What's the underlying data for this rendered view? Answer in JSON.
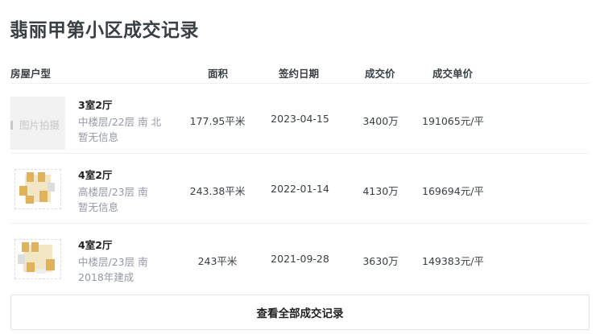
{
  "title": "翡丽甲第小区成交记录",
  "headers": {
    "layout": "房屋户型",
    "area": "面积",
    "date": "签约日期",
    "price": "成交价",
    "unit_price": "成交单价"
  },
  "placeholder_text": "图片拍摄",
  "records": [
    {
      "rooms": "3室2厅",
      "floor": "中楼层/22层 南 北",
      "extra": "暂无信息",
      "area": "177.95平米",
      "date": "2023-04-15",
      "price": "3400万",
      "unit_price": "191065元/平"
    },
    {
      "rooms": "4室2厅",
      "floor": "高楼层/23层 南",
      "extra": "暂无信息",
      "area": "243.38平米",
      "date": "2022-01-14",
      "price": "4130万",
      "unit_price": "169694元/平"
    },
    {
      "rooms": "4室2厅",
      "floor": "中楼层/23层 南",
      "extra": "2018年建成",
      "area": "243平米",
      "date": "2021-09-28",
      "price": "3630万",
      "unit_price": "149383元/平"
    }
  ],
  "more_button": "查看全部成交记录"
}
